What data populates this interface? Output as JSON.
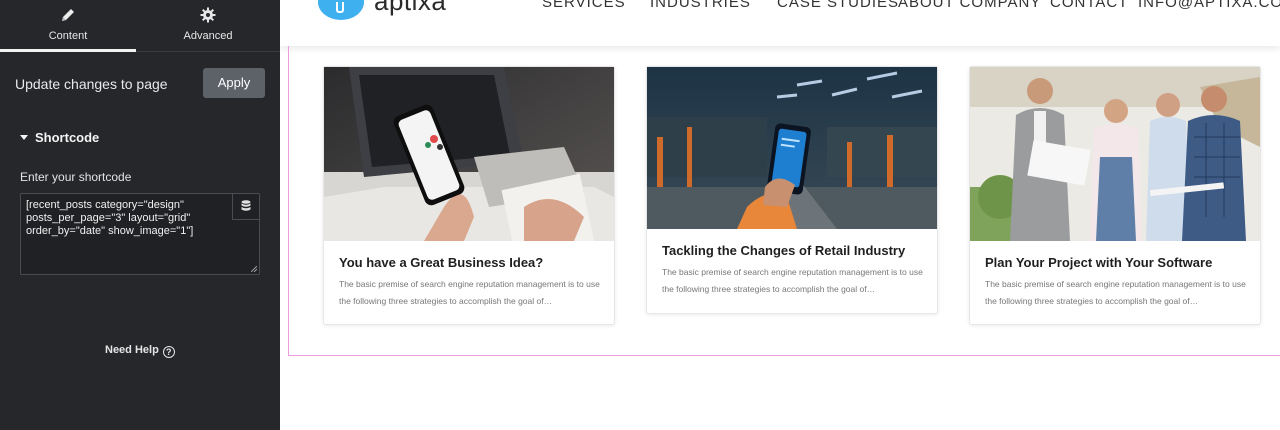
{
  "panel": {
    "tabs": [
      {
        "label": "Content",
        "icon": "pencil-icon"
      },
      {
        "label": "Advanced",
        "icon": "gear-icon"
      }
    ],
    "update_text": "Update changes to page",
    "apply_label": "Apply",
    "section_title": "Shortcode",
    "shortcode_label": "Enter your shortcode",
    "shortcode_value": "[recent_posts category=\"design\" posts_per_page=\"3\" layout=\"grid\" order_by=\"date\" show_image=\"1\"]",
    "need_help": "Need Help",
    "help_glyph": "?"
  },
  "site": {
    "logo_text": "aptixa",
    "nav": [
      "SERVICES",
      "INDUSTRIES",
      "CASE STUDIES",
      "ABOUT COMPANY",
      "CONTACT",
      "INFO@APTIXA.COM"
    ]
  },
  "posts": [
    {
      "title": "You have a Great Business Idea?",
      "excerpt": "The basic premise of search engine reputation management is to use the following three strategies to accomplish the goal of…"
    },
    {
      "title": "Tackling the Changes of Retail Industry",
      "excerpt": "The basic premise of search engine reputation management is to use the following three strategies to accomplish the goal of…"
    },
    {
      "title": "Plan Your Project with Your Software",
      "excerpt": "The basic premise of search engine reputation management is to use the following three strategies to accomplish the goal of…"
    }
  ],
  "colors": {
    "panel_bg": "#26272b",
    "apply_bg": "#5d6168",
    "brand": "#3fb0ef",
    "frame": "#f19be3"
  }
}
